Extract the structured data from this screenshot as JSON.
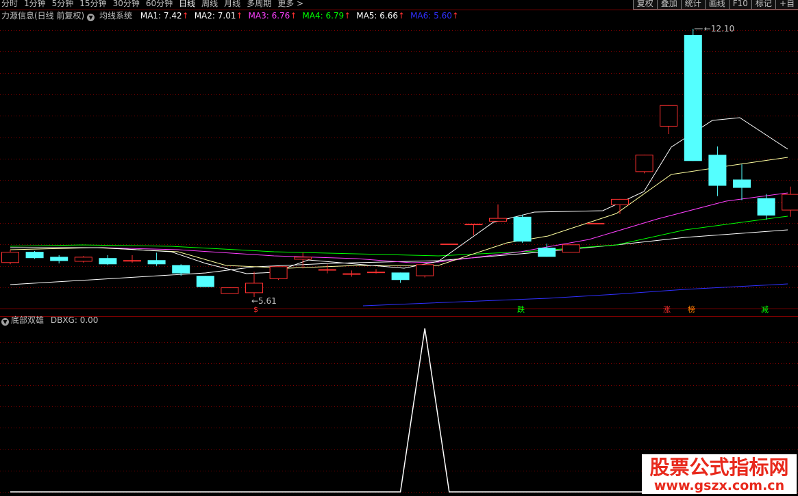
{
  "toolbar": {
    "tabs": [
      "分时",
      "1分钟",
      "5分钟",
      "15分钟",
      "30分钟",
      "60分钟",
      "日线",
      "周线",
      "月线",
      "多周期",
      "更多 >"
    ],
    "active_tab": "日线",
    "right_buttons": [
      "复权",
      "叠加",
      "统计",
      "画线",
      "F10",
      "标记",
      "+自"
    ]
  },
  "main_header": {
    "stock": "力源信息(日线 前复权)",
    "system": "均线系统",
    "ma": [
      {
        "label": "MA1: 7.42",
        "color": "#ffffff"
      },
      {
        "label": "MA2: 7.01",
        "color": "#ffffff"
      },
      {
        "label": "MA3: 6.76",
        "color": "#ff40ff"
      },
      {
        "label": "MA4: 6.79",
        "color": "#00ff00"
      },
      {
        "label": "MA5: 6.66",
        "color": "#ffffff"
      },
      {
        "label": "MA6: 5.60",
        "color": "#3030ff"
      }
    ],
    "arrow": "↑"
  },
  "indicator_header": {
    "name": "底部双雄",
    "value": "DBXG: 0.00"
  },
  "price_labels": {
    "high": "12.10",
    "low": "5.61"
  },
  "signals": [
    {
      "text": "$",
      "color": "#ff3030"
    },
    {
      "text": "跌",
      "color": "#00ff00"
    },
    {
      "text": "涨",
      "color": "#ff3030"
    },
    {
      "text": "榜",
      "color": "#ff8000"
    },
    {
      "text": "减",
      "color": "#00ff00"
    }
  ],
  "colors": {
    "up": "#ff3030",
    "down": "#54ffff",
    "grid": "#800000",
    "indicator_line": "#ffffff"
  },
  "chart_data": {
    "type": "candlestick",
    "low_marker": 5.61,
    "high_marker": 12.1,
    "candles": [
      {
        "o": 6.45,
        "c": 6.7,
        "h": 6.75,
        "l": 6.4,
        "dir": "up"
      },
      {
        "o": 6.7,
        "c": 6.55,
        "h": 6.72,
        "l": 6.53,
        "dir": "down"
      },
      {
        "o": 6.58,
        "c": 6.48,
        "h": 6.62,
        "l": 6.42,
        "dir": "down"
      },
      {
        "o": 6.48,
        "c": 6.58,
        "h": 6.6,
        "l": 6.44,
        "dir": "up"
      },
      {
        "o": 6.55,
        "c": 6.4,
        "h": 6.62,
        "l": 6.38,
        "dir": "down"
      },
      {
        "o": 6.5,
        "c": 6.5,
        "h": 6.62,
        "l": 6.44,
        "dir": "up"
      },
      {
        "o": 6.5,
        "c": 6.4,
        "h": 6.68,
        "l": 6.36,
        "dir": "down"
      },
      {
        "o": 6.38,
        "c": 6.18,
        "h": 6.4,
        "l": 6.12,
        "dir": "down"
      },
      {
        "o": 6.12,
        "c": 5.85,
        "h": 6.12,
        "l": 5.85,
        "dir": "down"
      },
      {
        "o": 5.7,
        "c": 5.84,
        "h": 5.84,
        "l": 5.7,
        "dir": "up"
      },
      {
        "o": 5.72,
        "c": 5.95,
        "h": 6.22,
        "l": 5.61,
        "dir": "up"
      },
      {
        "o": 6.06,
        "c": 6.35,
        "h": 6.35,
        "l": 6.02,
        "dir": "up"
      },
      {
        "o": 6.53,
        "c": 6.58,
        "h": 6.68,
        "l": 6.3,
        "dir": "up"
      },
      {
        "o": 6.28,
        "c": 6.28,
        "h": 6.4,
        "l": 6.18,
        "dir": "up"
      },
      {
        "o": 6.18,
        "c": 6.18,
        "h": 6.25,
        "l": 6.1,
        "dir": "up"
      },
      {
        "o": 6.22,
        "c": 6.22,
        "h": 6.28,
        "l": 6.18,
        "dir": "up"
      },
      {
        "o": 6.2,
        "c": 6.02,
        "h": 6.2,
        "l": 5.95,
        "dir": "down"
      },
      {
        "o": 6.13,
        "c": 6.4,
        "h": 6.4,
        "l": 6.08,
        "dir": "up"
      },
      {
        "o": 6.9,
        "c": 6.9,
        "h": 6.9,
        "l": 6.9,
        "dir": "up"
      },
      {
        "o": 7.38,
        "c": 7.38,
        "h": 7.38,
        "l": 7.1,
        "dir": "up"
      },
      {
        "o": 7.45,
        "c": 7.52,
        "h": 7.85,
        "l": 7.45,
        "dir": "up"
      },
      {
        "o": 7.55,
        "c": 6.95,
        "h": 7.6,
        "l": 6.92,
        "dir": "down"
      },
      {
        "o": 6.58,
        "c": 6.8,
        "h": 6.9,
        "l": 6.58,
        "dir": "down"
      },
      {
        "o": 6.7,
        "c": 6.88,
        "h": 6.88,
        "l": 6.7,
        "dir": "up"
      },
      {
        "o": 7.4,
        "c": 7.4,
        "h": 7.4,
        "l": 7.4,
        "dir": "up"
      },
      {
        "o": 7.85,
        "c": 7.98,
        "h": 7.98,
        "l": 7.62,
        "dir": "up"
      },
      {
        "o": 8.65,
        "c": 9.05,
        "h": 9.05,
        "l": 8.6,
        "dir": "up"
      },
      {
        "o": 9.75,
        "c": 10.25,
        "h": 10.25,
        "l": 9.55,
        "dir": "up"
      },
      {
        "o": 11.95,
        "c": 8.9,
        "h": 12.1,
        "l": 8.9,
        "dir": "down"
      },
      {
        "o": 9.05,
        "c": 8.3,
        "h": 9.25,
        "l": 8.05,
        "dir": "down"
      },
      {
        "o": 8.45,
        "c": 8.25,
        "h": 8.82,
        "l": 7.95,
        "dir": "down"
      },
      {
        "o": 8.0,
        "c": 7.58,
        "h": 8.1,
        "l": 7.48,
        "dir": "down"
      },
      {
        "o": 7.72,
        "c": 8.1,
        "h": 8.28,
        "l": 7.55,
        "dir": "up"
      }
    ],
    "indicator": {
      "name": "DBXG",
      "values": [
        0,
        0,
        0,
        0,
        0,
        0,
        0,
        0,
        0,
        0,
        0,
        0,
        0,
        0,
        0,
        0,
        0,
        1,
        0,
        0,
        0,
        0,
        0,
        0,
        0,
        0,
        0,
        0,
        0,
        0,
        0,
        0,
        0
      ]
    }
  }
}
